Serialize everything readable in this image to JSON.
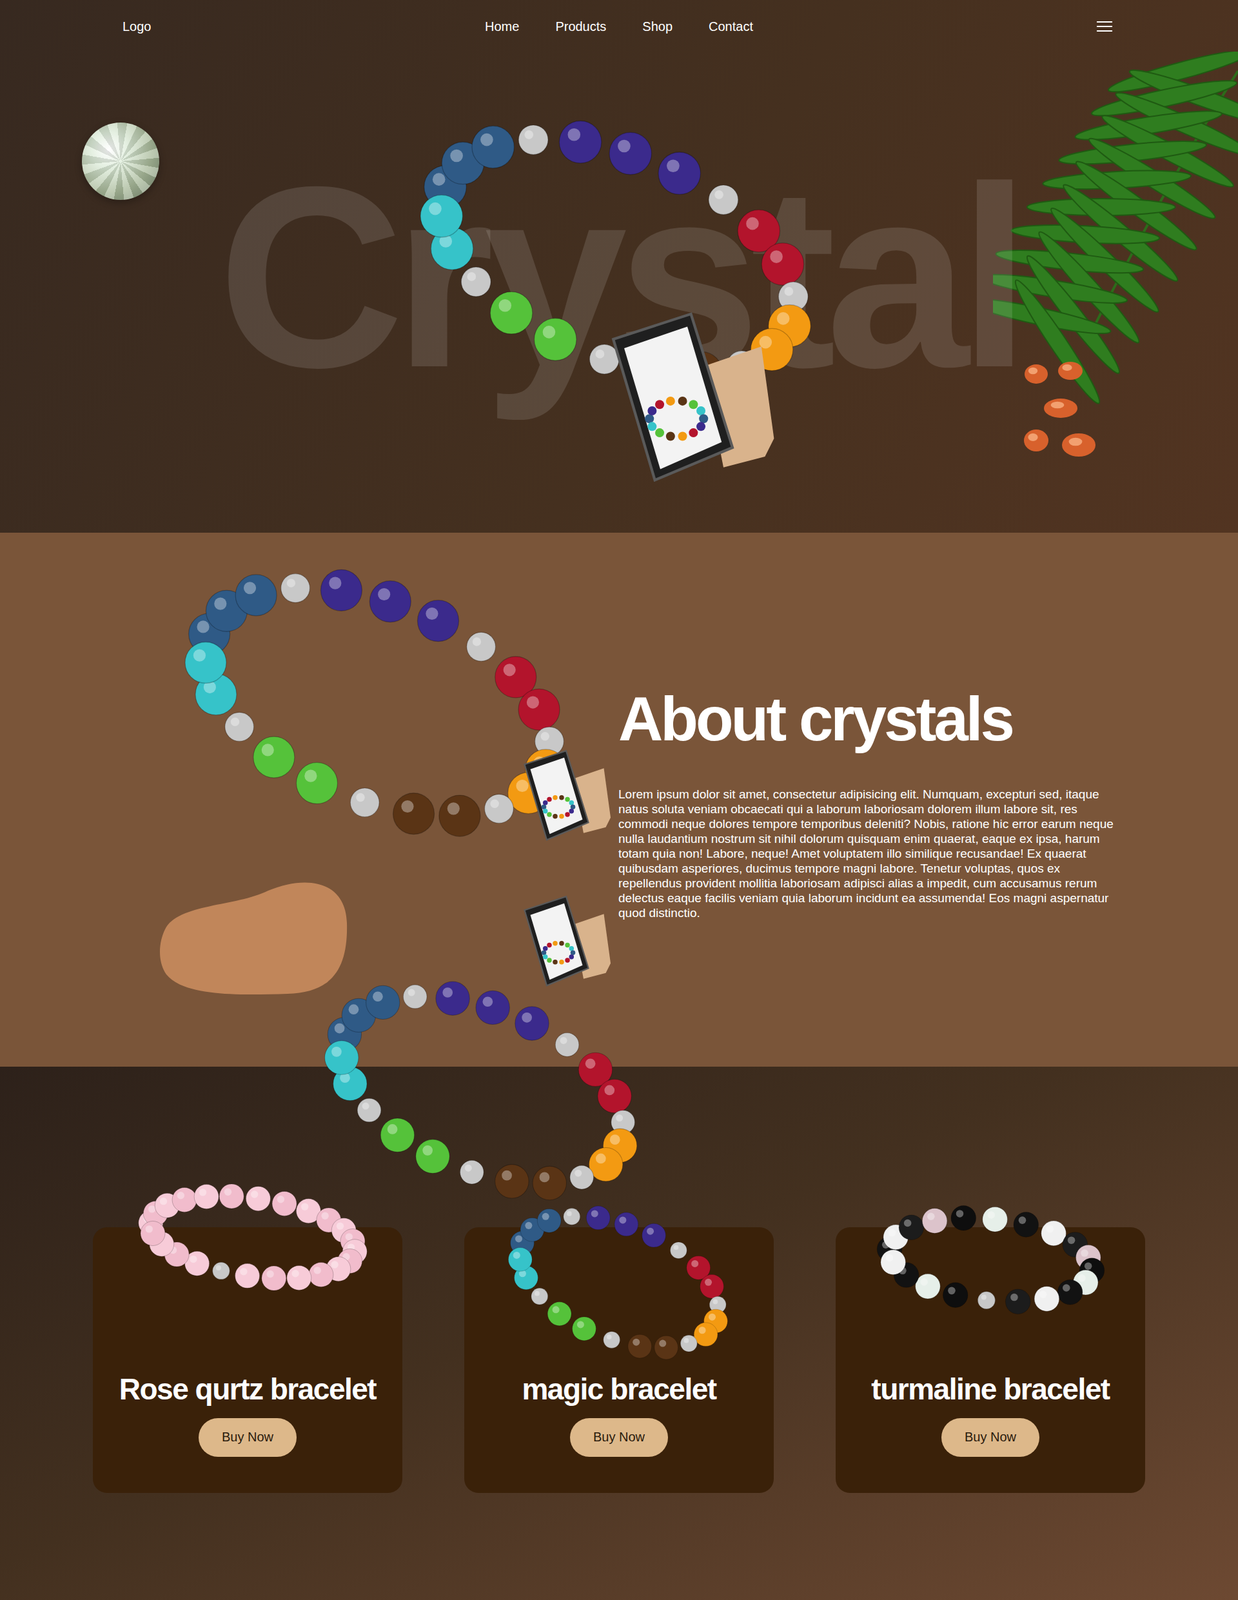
{
  "nav": {
    "logo": "Logo",
    "links": [
      "Home",
      "Products",
      "Shop",
      "Contact"
    ]
  },
  "hero": {
    "watermark": "Crystal"
  },
  "about": {
    "title": "About crystals",
    "body": "Lorem ipsum dolor sit amet, consectetur adipisicing elit. Numquam, excepturi sed, itaque natus soluta veniam obcaecati qui a laborum laboriosam dolorem illum labore sit, res commodi neque dolores tempore temporibus deleniti? Nobis, ratione hic error earum neque nulla laudantium nostrum sit nihil dolorum quisquam enim quaerat, eaque ex ipsa, harum totam quia non! Labore, neque! Amet voluptatem illo similique recusandae! Ex quaerat quibusdam asperiores, ducimus tempore magni labore. Tenetur voluptas, quos ex repellendus provident mollitia laboriosam adipisci alias a impedit, cum accusamus rerum delectus eaque facilis veniam quia laborum incidunt ea assumenda! Eos magni aspernatur quod distinctio."
  },
  "products": [
    {
      "name": "Rose qurtz bracelet",
      "button": "Buy Now"
    },
    {
      "name": "magic bracelet",
      "button": "Buy Now"
    },
    {
      "name": "turmaline bracelet",
      "button": "Buy Now"
    }
  ]
}
